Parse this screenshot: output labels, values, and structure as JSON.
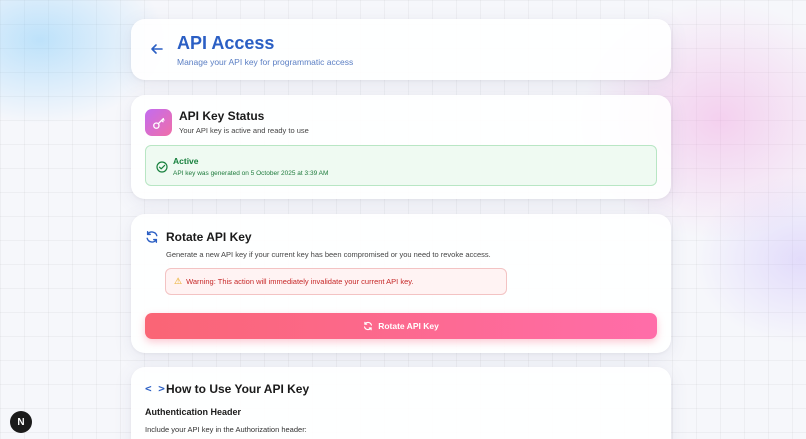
{
  "header": {
    "title": "API Access",
    "subtitle": "Manage your API key for programmatic access",
    "back_icon": "arrow-left-icon"
  },
  "status": {
    "title": "API Key Status",
    "description": "Your API key is active and ready to use",
    "icon": "key-icon",
    "active_label": "Active",
    "active_detail": "API key was generated on 5 October 2025 at 3:39 AM"
  },
  "rotate": {
    "title": "Rotate API Key",
    "description": "Generate a new API key if your current key has been compromised or you need to revoke access.",
    "warning": "Warning: This action will immediately invalidate your current API key.",
    "button_label": "Rotate API Key",
    "icon": "refresh-icon"
  },
  "howto": {
    "title": "How to Use Your API Key",
    "code_icon": "< >",
    "auth_heading": "Authentication Header",
    "auth_desc": "Include your API key in the Authorization header:"
  },
  "badge": {
    "label": "N"
  },
  "colors": {
    "accent_blue": "#2b5fc4",
    "success_green": "#17803d",
    "danger_red": "#c62828",
    "button_gradient_start": "#fa6575",
    "button_gradient_end": "#ff6da9"
  }
}
